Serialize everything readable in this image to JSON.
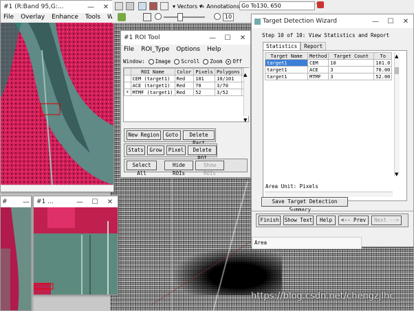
{
  "main_window": {
    "title": "#1 (R:Band 95,G:...",
    "menu": [
      "File",
      "Overlay",
      "Enhance",
      "Tools",
      "Window"
    ]
  },
  "zoom_window": {
    "title": "#1 ..."
  },
  "toolbar": {
    "vectors_label": "Vectors",
    "annotations_label": "Annotations",
    "goto_value": "Go To130, 650",
    "zoom_value": "10"
  },
  "roi_tool": {
    "title": "#1 ROI Tool",
    "menu": [
      "File",
      "ROI_Type",
      "Options",
      "Help"
    ],
    "window_label": "Window:",
    "window_options": [
      "Image",
      "Scroll",
      "Zoom",
      "Off"
    ],
    "selected_window": "Off",
    "columns": [
      "ROI Name",
      "Color",
      "Pixels",
      "Polygons",
      "P"
    ],
    "rows": [
      {
        "marker": "",
        "name": "CEM (target1)",
        "color": "Red",
        "pixels": "101",
        "polygons": "10/101",
        "p": "0"
      },
      {
        "marker": "",
        "name": "ACE (target1)",
        "color": "Red",
        "pixels": "70",
        "polygons": "3/70",
        "p": "0"
      },
      {
        "marker": "*",
        "name": "MTMF (target1)",
        "color": "Red",
        "pixels": "52",
        "polygons": "3/52",
        "p": "0"
      }
    ],
    "buttons": {
      "new_region": "New Region",
      "goto": "Goto",
      "delete_part": "Delete Part",
      "stats": "Stats",
      "grow": "Grow",
      "pixel": "Pixel",
      "delete_roi": "Delete ROI",
      "select_all": "Select All",
      "hide_rois": "Hide ROIs",
      "show_rois": "Show ROIs"
    }
  },
  "wizard": {
    "title": "Target Detection Wizard",
    "step_label": "Step 10 of 10: View Statistics and Report",
    "tabs": [
      "Statistics",
      "Report"
    ],
    "columns": [
      "Target Name",
      "Method",
      "Target Count",
      "To"
    ],
    "rows": [
      {
        "target": "target1",
        "method": "CEM",
        "count": "10",
        "total": "101.0"
      },
      {
        "target": "target1",
        "method": "ACE",
        "count": "3",
        "total": "70.00"
      },
      {
        "target": "target1",
        "method": "MTMF",
        "count": "3",
        "total": "52.00"
      }
    ],
    "area_unit": "Area Unit: Pixels",
    "save_button": "Save Target Detection Summary...",
    "buttons": {
      "finish": "Finish",
      "show_text": "Show Text",
      "help": "Help",
      "prev": "<-- Prev",
      "next": "Next -->"
    },
    "area_label": "Area"
  },
  "watermark": "https://blog.csdn.net/chengzjlhc"
}
